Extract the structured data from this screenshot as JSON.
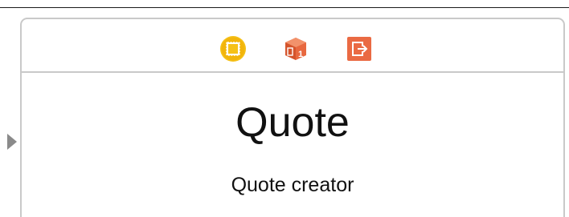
{
  "scene": {
    "title": "Quote",
    "subtitle": "Quote creator"
  },
  "dock": {
    "icons": [
      {
        "name": "view-controller-icon",
        "color": "#f5c118"
      },
      {
        "name": "first-responder-icon",
        "color": "#e8683f"
      },
      {
        "name": "exit-icon",
        "color": "#ea6a43"
      }
    ],
    "first_responder_badge": "1"
  },
  "colors": {
    "border": "#c9c9c9",
    "text": "#111111",
    "entry_arrow": "#8a8a8a"
  }
}
